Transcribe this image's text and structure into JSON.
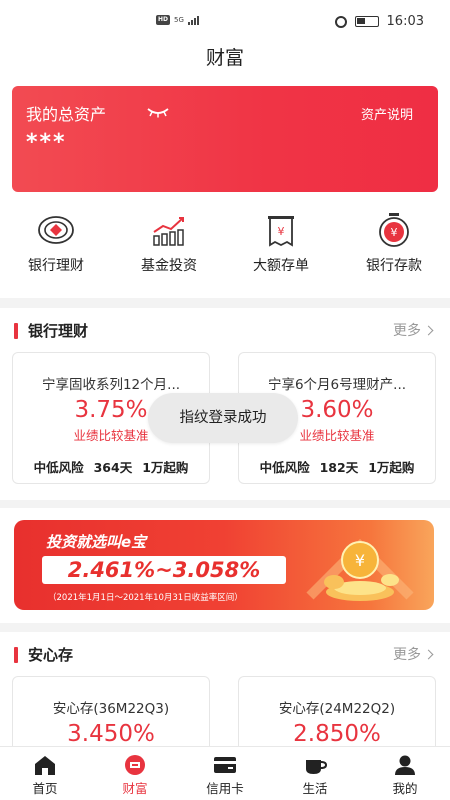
{
  "status_bar": {
    "hd": "HD",
    "signal": "5G",
    "time": "16:03"
  },
  "header": {
    "title": "财富"
  },
  "asset_card": {
    "title": "我的总资产",
    "link": "资产说明",
    "value": "***",
    "icon": "eye-closed-icon"
  },
  "quick_entries": [
    {
      "label": "银行理财",
      "icon": "bank-finance-icon"
    },
    {
      "label": "基金投资",
      "icon": "fund-chart-icon"
    },
    {
      "label": "大额存单",
      "icon": "deposit-certificate-icon"
    },
    {
      "label": "银行存款",
      "icon": "bank-deposit-icon"
    }
  ],
  "section_finance": {
    "title": "银行理财",
    "more": "更多",
    "products": [
      {
        "name": "宁享固收系列12个月...",
        "rate": "3.75%",
        "desc": "业绩比较基准",
        "risk": "中低风险",
        "term": "364天",
        "min": "1万起购"
      },
      {
        "name": "宁享6个月6号理财产...",
        "rate": "3.60%",
        "desc": "业绩比较基准",
        "risk": "中低风险",
        "term": "182天",
        "min": "1万起购"
      }
    ]
  },
  "toast": {
    "text": "指纹登录成功"
  },
  "banner": {
    "title": "投资就选叫e宝",
    "rate": "2.461%~3.058%",
    "note": "（2021年1月1日～2021年10月31日收益率区间）"
  },
  "section_deposit": {
    "title": "安心存",
    "more": "更多",
    "products": [
      {
        "name": "安心存(36M22Q3)",
        "rate": "3.450%"
      },
      {
        "name": "安心存(24M22Q2)",
        "rate": "2.850%"
      }
    ]
  },
  "tabbar": {
    "items": [
      {
        "label": "首页",
        "icon": "home-icon"
      },
      {
        "label": "财富",
        "icon": "wealth-icon"
      },
      {
        "label": "信用卡",
        "icon": "credit-card-icon"
      },
      {
        "label": "生活",
        "icon": "cup-icon"
      },
      {
        "label": "我的",
        "icon": "user-icon"
      }
    ],
    "active": "财富"
  },
  "colors": {
    "accent": "#e8343f",
    "card_gradient_start": "#f24b52",
    "card_gradient_end": "#ef2e44"
  }
}
